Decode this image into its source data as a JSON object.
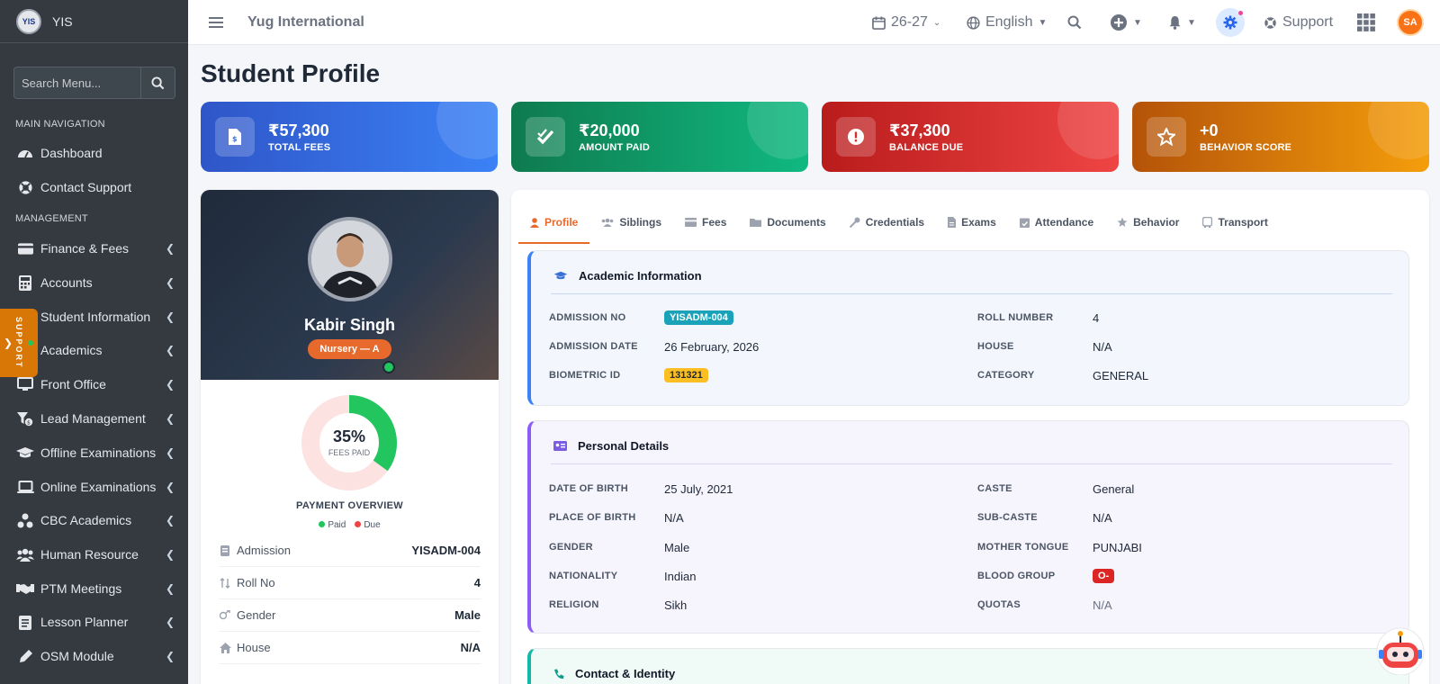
{
  "app": {
    "brand_name": "YIS",
    "org_name": "Yug International",
    "logo_text": "YIS"
  },
  "sidebar": {
    "search_placeholder": "Search Menu...",
    "main_nav_header": "MAIN NAVIGATION",
    "management_header": "MANAGEMENT",
    "main_items": [
      {
        "label": "Dashboard",
        "icon": "dashboard-icon"
      },
      {
        "label": "Contact Support",
        "icon": "life-ring-icon"
      }
    ],
    "management_items": [
      {
        "label": "Finance & Fees",
        "icon": "finance-icon"
      },
      {
        "label": "Accounts",
        "icon": "calculator-icon"
      },
      {
        "label": "Student Information",
        "icon": "student-icon"
      },
      {
        "label": "Academics",
        "icon": "book-icon"
      },
      {
        "label": "Front Office",
        "icon": "monitor-icon"
      },
      {
        "label": "Lead Management",
        "icon": "funnel-icon"
      },
      {
        "label": "Offline Examinations",
        "icon": "graduation-cap-icon"
      },
      {
        "label": "Online Examinations",
        "icon": "laptop-icon"
      },
      {
        "label": "CBC Academics",
        "icon": "network-icon"
      },
      {
        "label": "Human Resource",
        "icon": "users-icon"
      },
      {
        "label": "PTM Meetings",
        "icon": "handshake-icon"
      },
      {
        "label": "Lesson Planner",
        "icon": "planner-icon"
      },
      {
        "label": "OSM Module",
        "icon": "pen-icon"
      }
    ],
    "support_tab": "SUPPORT"
  },
  "topbar": {
    "session": "26-27",
    "language": "English",
    "support_label": "Support",
    "avatar_initials": "SA"
  },
  "page": {
    "title": "Student Profile"
  },
  "stats": [
    {
      "value": "₹57,300",
      "label": "TOTAL FEES",
      "color_from": "#2f56c8",
      "color_to": "#3b82f6",
      "icon": "invoice-icon"
    },
    {
      "value": "₹20,000",
      "label": "AMOUNT PAID",
      "color_from": "#0f7a4f",
      "color_to": "#10b981",
      "icon": "check-icon"
    },
    {
      "value": "₹37,300",
      "label": "BALANCE DUE",
      "color_from": "#b91c1c",
      "color_to": "#ef4444",
      "icon": "alert-icon"
    },
    {
      "value": "+0",
      "label": "BEHAVIOR SCORE",
      "color_from": "#b45309",
      "color_to": "#f59e0b",
      "icon": "star-icon"
    }
  ],
  "profile": {
    "name": "Kabir Singh",
    "class": "Nursery — A",
    "fees_paid_percent": 35,
    "fees_paid_text": "35%",
    "fees_paid_label": "FEES PAID",
    "payment_overview": "PAYMENT OVERVIEW",
    "legend_paid": "Paid",
    "legend_due": "Due",
    "rows": [
      {
        "key": "Admission",
        "value": "YISADM-004",
        "icon": "id-card-icon"
      },
      {
        "key": "Roll No",
        "value": "4",
        "icon": "sort-icon"
      },
      {
        "key": "Gender",
        "value": "Male",
        "icon": "gender-icon"
      },
      {
        "key": "House",
        "value": "N/A",
        "icon": "home-icon"
      }
    ]
  },
  "tabs": [
    {
      "label": "Profile",
      "icon": "user-icon",
      "active": true
    },
    {
      "label": "Siblings",
      "icon": "users-icon"
    },
    {
      "label": "Fees",
      "icon": "money-icon"
    },
    {
      "label": "Documents",
      "icon": "folder-icon"
    },
    {
      "label": "Credentials",
      "icon": "key-icon"
    },
    {
      "label": "Exams",
      "icon": "file-icon"
    },
    {
      "label": "Attendance",
      "icon": "calendar-check-icon"
    },
    {
      "label": "Behavior",
      "icon": "star-icon"
    },
    {
      "label": "Transport",
      "icon": "bus-icon"
    }
  ],
  "academic": {
    "title": "Academic Information",
    "admission_no_label": "ADMISSION NO",
    "admission_no": "YISADM-004",
    "admission_date_label": "ADMISSION DATE",
    "admission_date": "26 February, 2026",
    "biometric_label": "BIOMETRIC ID",
    "biometric": "131321",
    "roll_label": "ROLL NUMBER",
    "roll": "4",
    "house_label": "HOUSE",
    "house": "N/A",
    "category_label": "CATEGORY",
    "category": "GENERAL"
  },
  "personal": {
    "title": "Personal Details",
    "dob_label": "DATE OF BIRTH",
    "dob": "25 July, 2021",
    "pob_label": "PLACE OF BIRTH",
    "pob": "N/A",
    "gender_label": "GENDER",
    "gender": "Male",
    "nationality_label": "NATIONALITY",
    "nationality": "Indian",
    "religion_label": "RELIGION",
    "religion": "Sikh",
    "caste_label": "CASTE",
    "caste": "General",
    "subcaste_label": "SUB-CASTE",
    "subcaste": "N/A",
    "tongue_label": "MOTHER TONGUE",
    "tongue": "PUNJABI",
    "blood_label": "BLOOD GROUP",
    "blood": "O-",
    "quotas_label": "QUOTAS",
    "quotas": "N/A"
  },
  "contact": {
    "title": "Contact & Identity"
  }
}
